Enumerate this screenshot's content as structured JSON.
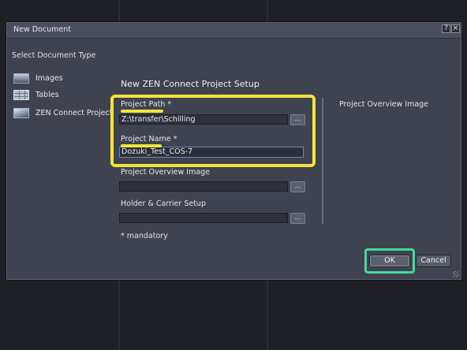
{
  "window": {
    "title": "New Document",
    "help_label": "?",
    "close_label": "×"
  },
  "sidebar": {
    "heading": "Select Document Type",
    "items": [
      {
        "label": "Images",
        "icon": "image-icon"
      },
      {
        "label": "Tables",
        "icon": "table-icon"
      },
      {
        "label": "ZEN Connect Project",
        "icon": "zen-project-icon"
      }
    ]
  },
  "setup": {
    "heading": "New ZEN Connect Project Setup",
    "project_path": {
      "label": "Project Path *",
      "value": "Z:\\transfer\\Schilling",
      "browse_label": "..."
    },
    "project_name": {
      "label": "Project Name *",
      "value": "Dozuki_Test_COS-7"
    },
    "overview_image": {
      "label": "Project Overview Image",
      "value": "",
      "browse_label": "..."
    },
    "holder_setup": {
      "label": "Holder & Carrier Setup",
      "value": "",
      "browse_label": "..."
    },
    "mandatory_note": "* mandatory"
  },
  "preview": {
    "label": "Project Overview Image"
  },
  "buttons": {
    "ok": "OK",
    "cancel": "Cancel"
  },
  "colors": {
    "dialog_bg": "#3f4350",
    "highlight_yellow": "#f2e53a",
    "highlight_green": "#3fdc9a"
  }
}
